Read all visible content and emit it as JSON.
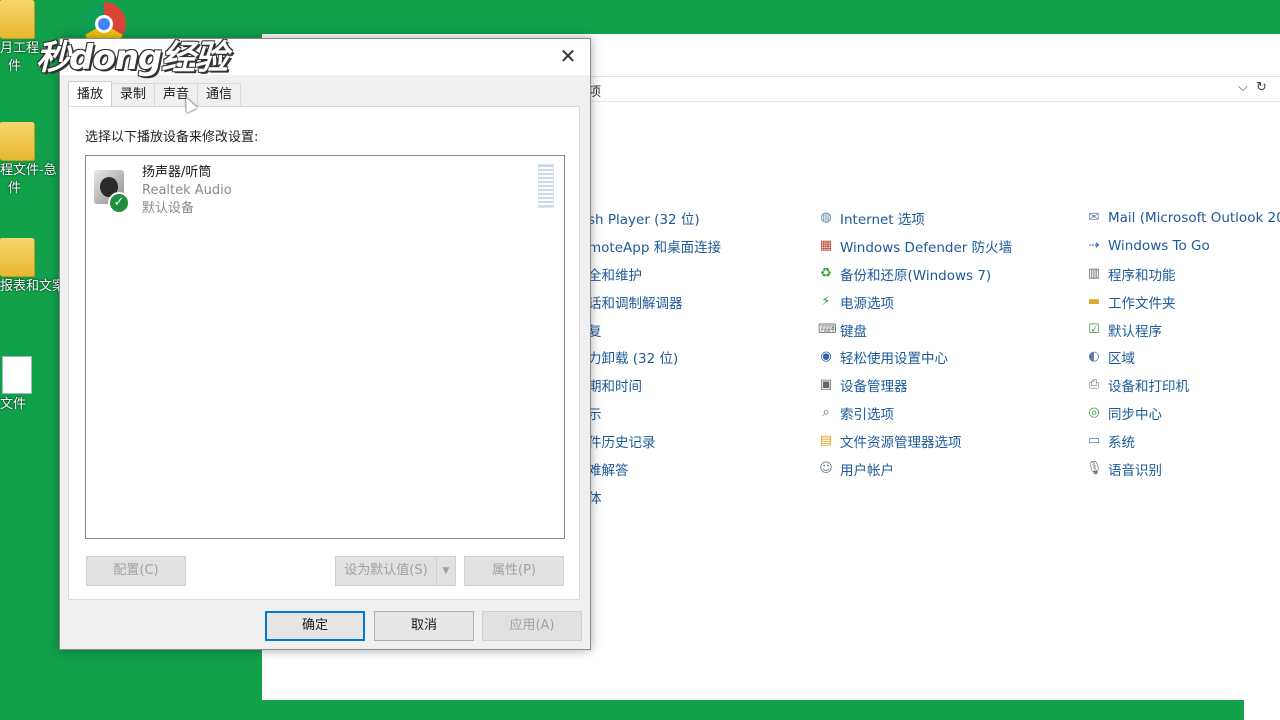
{
  "desktop": {
    "icons": [
      {
        "label_line1": "月工程",
        "label_line2": "件",
        "kind": "folder"
      },
      {
        "label_line1": "程文件-急",
        "label_line2": "件",
        "kind": "folder"
      },
      {
        "label_line1": "报表和文案",
        "label_line2": "",
        "kind": "folder"
      },
      {
        "label_line1": "文件",
        "label_line2": "",
        "kind": "document"
      }
    ],
    "watermark": "秒dong经验",
    "background_color": "#11a14a"
  },
  "control_panel": {
    "address_text": "项",
    "columns": [
      {
        "items": [
          {
            "label": "sh Player (32 位)",
            "icon": "flash-icon"
          },
          {
            "label": "moteApp 和桌面连接",
            "icon": "remoteapp-icon"
          },
          {
            "label": "全和维护",
            "icon": "security-icon"
          },
          {
            "label": "话和调制解调器",
            "icon": "phone-icon"
          },
          {
            "label": "复",
            "icon": "recovery-icon"
          },
          {
            "label": "力卸载 (32 位)",
            "icon": "uninstall-icon"
          },
          {
            "label": "期和时间",
            "icon": "clock-icon"
          },
          {
            "label": "示",
            "icon": "display-icon"
          },
          {
            "label": "件历史记录",
            "icon": "history-icon"
          },
          {
            "label": "难解答",
            "icon": "troubleshoot-icon"
          },
          {
            "label": "体",
            "icon": "font-icon"
          }
        ]
      },
      {
        "items": [
          {
            "label": "Internet 选项",
            "icon": "globe-icon"
          },
          {
            "label": "Windows Defender 防火墙",
            "icon": "firewall-icon"
          },
          {
            "label": "备份和还原(Windows 7)",
            "icon": "backup-icon"
          },
          {
            "label": "电源选项",
            "icon": "power-icon"
          },
          {
            "label": "键盘",
            "icon": "keyboard-icon"
          },
          {
            "label": "轻松使用设置中心",
            "icon": "accessibility-icon"
          },
          {
            "label": "设备管理器",
            "icon": "device-manager-icon"
          },
          {
            "label": "索引选项",
            "icon": "search-icon"
          },
          {
            "label": "文件资源管理器选项",
            "icon": "folder-options-icon"
          },
          {
            "label": "用户帐户",
            "icon": "users-icon"
          }
        ]
      },
      {
        "items": [
          {
            "label": "Mail (Microsoft Outlook 20",
            "icon": "mail-icon"
          },
          {
            "label": "Windows To Go",
            "icon": "usb-icon"
          },
          {
            "label": "程序和功能",
            "icon": "programs-icon"
          },
          {
            "label": "工作文件夹",
            "icon": "work-folders-icon"
          },
          {
            "label": "默认程序",
            "icon": "default-programs-icon"
          },
          {
            "label": "区域",
            "icon": "region-icon"
          },
          {
            "label": "设备和打印机",
            "icon": "printer-icon"
          },
          {
            "label": "同步中心",
            "icon": "sync-icon"
          },
          {
            "label": "系统",
            "icon": "system-icon"
          },
          {
            "label": "语音识别",
            "icon": "microphone-icon"
          }
        ]
      }
    ]
  },
  "sound_dialog": {
    "close_glyph": "✕",
    "tabs": [
      "播放",
      "录制",
      "声音",
      "通信"
    ],
    "active_tab": 0,
    "instruction": "选择以下播放设备来修改设置:",
    "devices": [
      {
        "name": "扬声器/听筒",
        "driver": "Realtek Audio",
        "status": "默认设备",
        "check_glyph": "✓"
      }
    ],
    "buttons": {
      "configure": "配置(C)",
      "set_default": "设为默认值(S)",
      "set_default_arrow": "▼",
      "properties": "属性(P)",
      "ok": "确定",
      "cancel": "取消",
      "apply": "应用(A)"
    }
  }
}
